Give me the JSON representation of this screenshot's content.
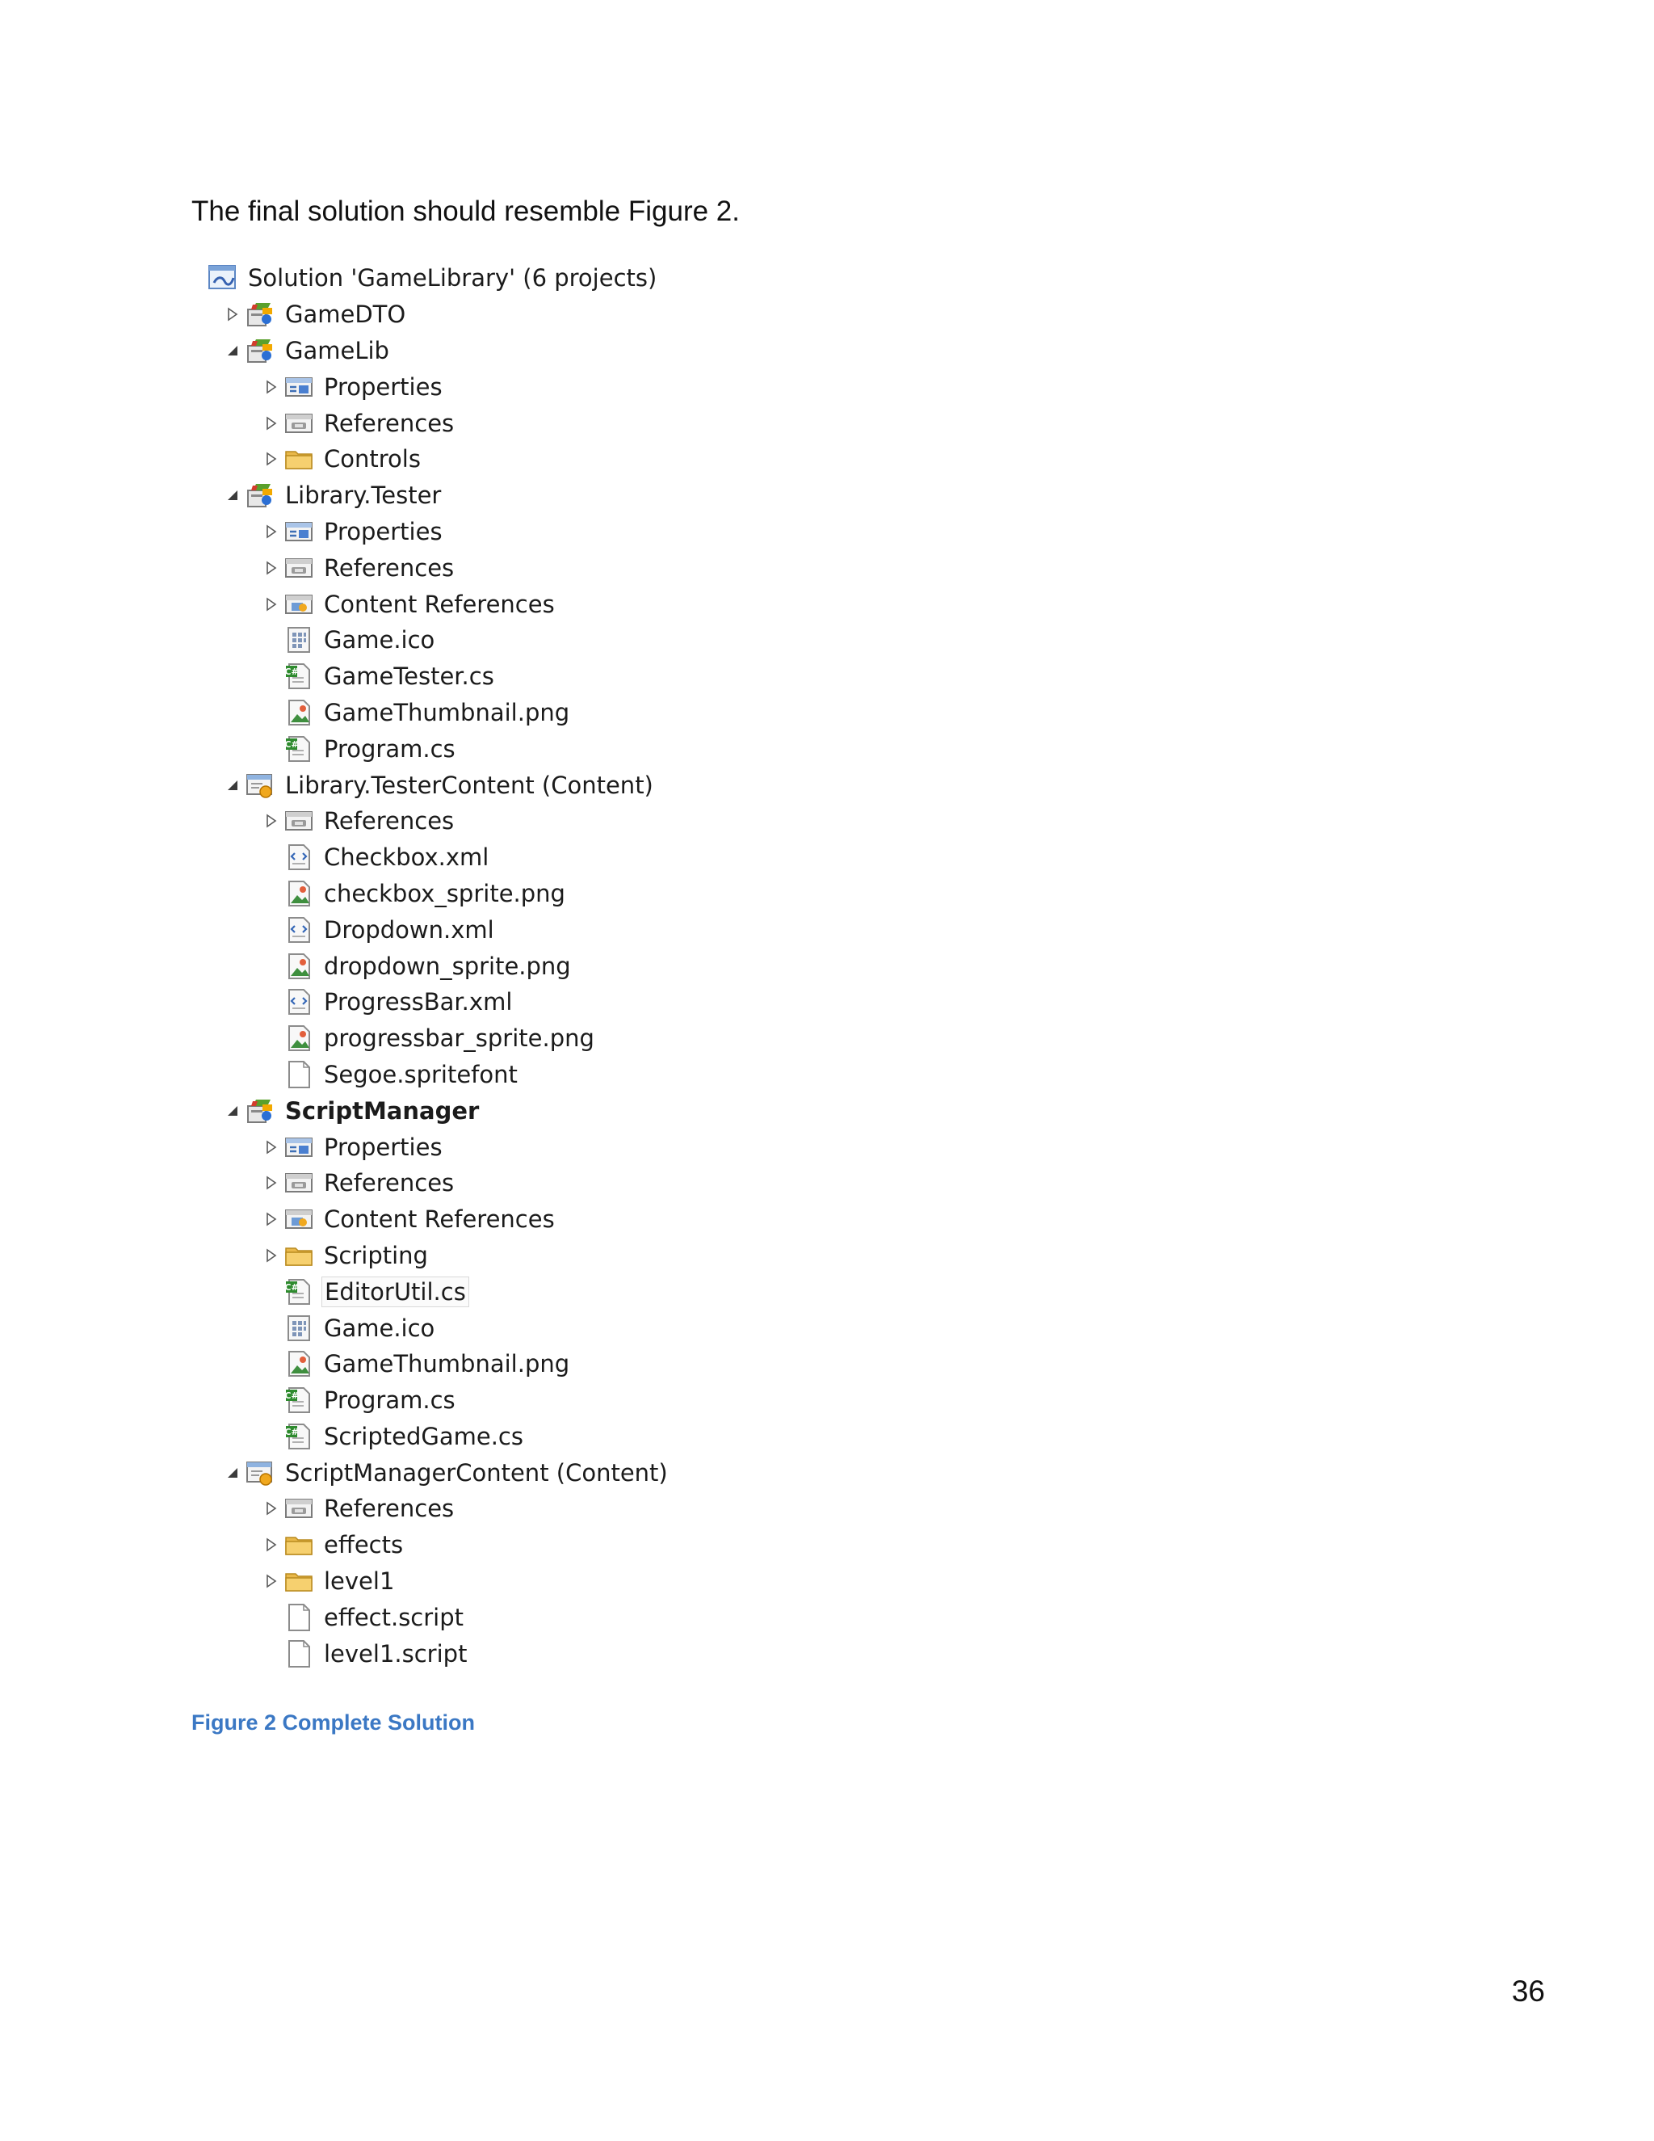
{
  "intro_text": "The final solution should resemble Figure 2.",
  "caption": "Figure 2 Complete Solution",
  "page_number": "36",
  "tree": [
    {
      "label": "Solution 'GameLibrary' (6 projects)",
      "depth": 0,
      "toggle": "none",
      "icon": "solution-icon"
    },
    {
      "label": "GameDTO",
      "depth": 1,
      "toggle": "collapsed",
      "icon": "csharp-project-icon"
    },
    {
      "label": "GameLib",
      "depth": 1,
      "toggle": "expanded",
      "icon": "csharp-project-icon"
    },
    {
      "label": "Properties",
      "depth": 2,
      "toggle": "collapsed",
      "icon": "properties-icon"
    },
    {
      "label": "References",
      "depth": 2,
      "toggle": "collapsed",
      "icon": "references-icon"
    },
    {
      "label": "Controls",
      "depth": 2,
      "toggle": "collapsed",
      "icon": "folder-icon"
    },
    {
      "label": "Library.Tester",
      "depth": 1,
      "toggle": "expanded",
      "icon": "csharp-project-icon"
    },
    {
      "label": "Properties",
      "depth": 2,
      "toggle": "collapsed",
      "icon": "properties-icon"
    },
    {
      "label": "References",
      "depth": 2,
      "toggle": "collapsed",
      "icon": "references-icon"
    },
    {
      "label": "Content References",
      "depth": 2,
      "toggle": "collapsed",
      "icon": "content-references-icon"
    },
    {
      "label": "Game.ico",
      "depth": 2,
      "toggle": "none",
      "icon": "ico-file-icon"
    },
    {
      "label": "GameTester.cs",
      "depth": 2,
      "toggle": "none",
      "icon": "csharp-file-icon"
    },
    {
      "label": "GameThumbnail.png",
      "depth": 2,
      "toggle": "none",
      "icon": "image-file-icon"
    },
    {
      "label": "Program.cs",
      "depth": 2,
      "toggle": "none",
      "icon": "csharp-file-icon"
    },
    {
      "label": "Library.TesterContent (Content)",
      "depth": 1,
      "toggle": "expanded",
      "icon": "content-project-icon"
    },
    {
      "label": "References",
      "depth": 2,
      "toggle": "collapsed",
      "icon": "references-icon"
    },
    {
      "label": "Checkbox.xml",
      "depth": 2,
      "toggle": "none",
      "icon": "xml-file-icon"
    },
    {
      "label": "checkbox_sprite.png",
      "depth": 2,
      "toggle": "none",
      "icon": "image-file-icon"
    },
    {
      "label": "Dropdown.xml",
      "depth": 2,
      "toggle": "none",
      "icon": "xml-file-icon"
    },
    {
      "label": "dropdown_sprite.png",
      "depth": 2,
      "toggle": "none",
      "icon": "image-file-icon"
    },
    {
      "label": "ProgressBar.xml",
      "depth": 2,
      "toggle": "none",
      "icon": "xml-file-icon"
    },
    {
      "label": "progressbar_sprite.png",
      "depth": 2,
      "toggle": "none",
      "icon": "image-file-icon"
    },
    {
      "label": "Segoe.spritefont",
      "depth": 2,
      "toggle": "none",
      "icon": "blank-file-icon"
    },
    {
      "label": "ScriptManager",
      "depth": 1,
      "toggle": "expanded",
      "icon": "csharp-project-icon",
      "bold": true
    },
    {
      "label": "Properties",
      "depth": 2,
      "toggle": "collapsed",
      "icon": "properties-icon"
    },
    {
      "label": "References",
      "depth": 2,
      "toggle": "collapsed",
      "icon": "references-icon"
    },
    {
      "label": "Content References",
      "depth": 2,
      "toggle": "collapsed",
      "icon": "content-references-icon"
    },
    {
      "label": "Scripting",
      "depth": 2,
      "toggle": "collapsed",
      "icon": "folder-icon"
    },
    {
      "label": "EditorUtil.cs",
      "depth": 2,
      "toggle": "none",
      "icon": "csharp-file-icon",
      "selected": true
    },
    {
      "label": "Game.ico",
      "depth": 2,
      "toggle": "none",
      "icon": "ico-file-icon"
    },
    {
      "label": "GameThumbnail.png",
      "depth": 2,
      "toggle": "none",
      "icon": "image-file-icon"
    },
    {
      "label": "Program.cs",
      "depth": 2,
      "toggle": "none",
      "icon": "csharp-file-icon"
    },
    {
      "label": "ScriptedGame.cs",
      "depth": 2,
      "toggle": "none",
      "icon": "csharp-file-icon"
    },
    {
      "label": "ScriptManagerContent (Content)",
      "depth": 1,
      "toggle": "expanded",
      "icon": "content-project-icon"
    },
    {
      "label": "References",
      "depth": 2,
      "toggle": "collapsed",
      "icon": "references-icon"
    },
    {
      "label": "effects",
      "depth": 2,
      "toggle": "collapsed",
      "icon": "folder-icon"
    },
    {
      "label": "level1",
      "depth": 2,
      "toggle": "collapsed",
      "icon": "folder-icon"
    },
    {
      "label": "effect.script",
      "depth": 2,
      "toggle": "none",
      "icon": "blank-file-icon"
    },
    {
      "label": "level1.script",
      "depth": 2,
      "toggle": "none",
      "icon": "blank-file-icon"
    }
  ]
}
